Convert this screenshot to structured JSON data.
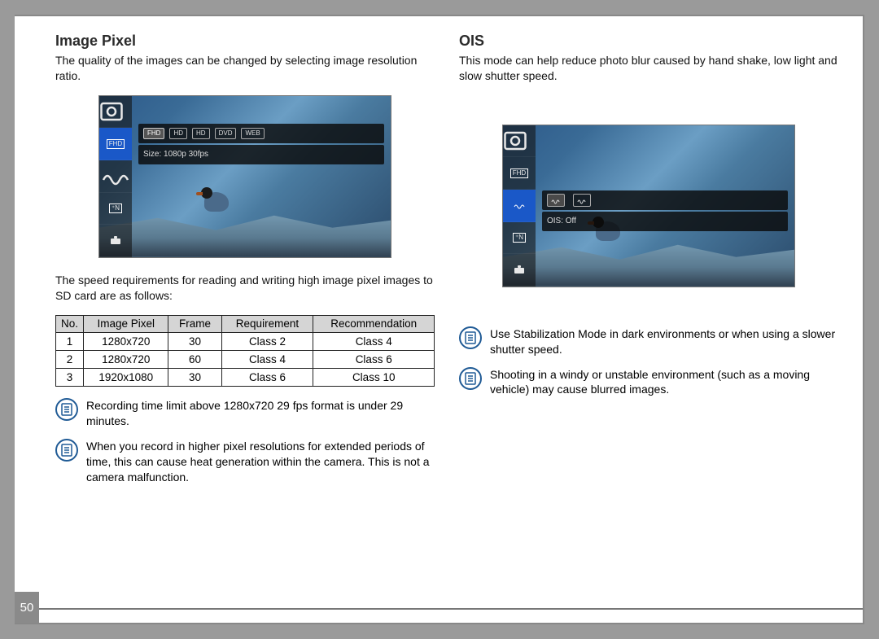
{
  "page_number": "50",
  "left": {
    "title": "Image Pixel",
    "intro": "The quality of the images can be changed by selecting image resolution ratio.",
    "shot": {
      "side_icons": [
        "camera-mode-icon",
        "fhd-icon",
        "ois-off-icon",
        "target-n-icon",
        "toolbox-icon"
      ],
      "selected_side": 1,
      "options": [
        "FHD",
        "HD",
        "HD",
        "DVD",
        "WEB"
      ],
      "selected_option": 0,
      "size_label": "Size: 1080p 30fps"
    },
    "speed_intro": "The speed requirements for reading and writing high image pixel images to SD card are as follows:",
    "table": {
      "headers": [
        "No.",
        "Image Pixel",
        "Frame",
        "Requirement",
        "Recommendation"
      ],
      "rows": [
        {
          "no": "1",
          "pixel": "1280x720",
          "frame": "30",
          "req": "Class 2",
          "rec": "Class 4"
        },
        {
          "no": "2",
          "pixel": "1280x720",
          "frame": "60",
          "req": "Class 4",
          "rec": "Class 6"
        },
        {
          "no": "3",
          "pixel": "1920x1080",
          "frame": "30",
          "req": "Class 6",
          "rec": "Class 10"
        }
      ]
    },
    "notes": [
      "Recording time limit above 1280x720 29 fps format is under 29 minutes.",
      "When you record in higher pixel resolutions for extended periods of time, this can cause heat generation within the camera. This is not a camera malfunction."
    ]
  },
  "right": {
    "title": "OIS",
    "intro": "This mode can help reduce photo blur caused by hand shake, low light and slow shutter speed.",
    "shot": {
      "side_icons": [
        "camera-mode-icon",
        "fhd-icon",
        "ois-off-icon",
        "target-n-icon",
        "toolbox-icon"
      ],
      "selected_side": 2,
      "ois_label": "OIS: Off"
    },
    "notes": [
      "Use Stabilization Mode in dark environments or when using a slower shutter speed.",
      "Shooting in a windy or unstable environment (such as a moving vehicle) may cause blurred images."
    ]
  }
}
